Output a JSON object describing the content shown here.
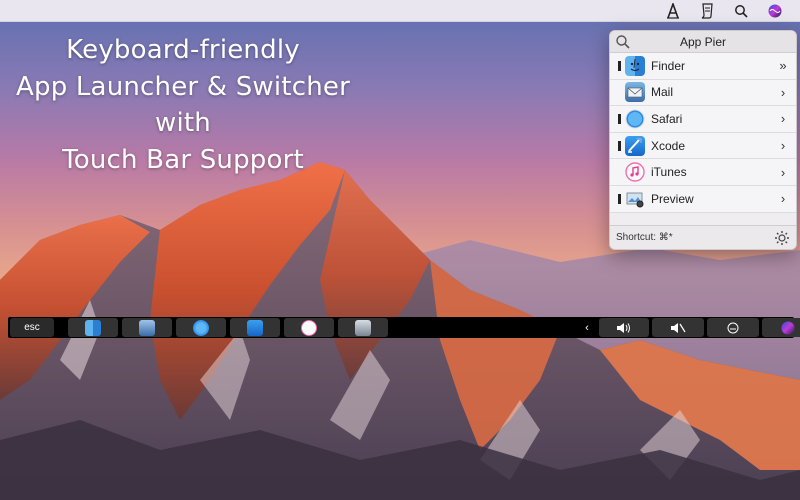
{
  "menubar": {
    "icons": [
      "app-pier-icon",
      "script-icon",
      "search-icon",
      "siri-icon"
    ]
  },
  "headline": {
    "lines": [
      "Keyboard-friendly",
      "App Launcher & Switcher",
      "with",
      "Touch Bar Support"
    ]
  },
  "panel": {
    "title": "App Pier",
    "apps": [
      {
        "name": "Finder",
        "running": true,
        "arrow": "»",
        "icon": "finder-icon"
      },
      {
        "name": "Mail",
        "running": false,
        "arrow": "›",
        "icon": "mail-icon"
      },
      {
        "name": "Safari",
        "running": true,
        "arrow": "›",
        "icon": "safari-icon"
      },
      {
        "name": "Xcode",
        "running": true,
        "arrow": "›",
        "icon": "xcode-icon"
      },
      {
        "name": "iTunes",
        "running": false,
        "arrow": "›",
        "icon": "itunes-icon"
      },
      {
        "name": "Preview",
        "running": true,
        "arrow": "›",
        "icon": "preview-icon"
      }
    ],
    "shortcut": "Shortcut: ⌘*"
  },
  "touchbar": {
    "esc": "esc",
    "apps": [
      "finder-icon",
      "preview-icon",
      "safari-icon",
      "xcode-icon",
      "itunes-icon",
      "scanner-icon"
    ],
    "controls": {
      "collapse": "‹",
      "volume": "volume-icon",
      "mute": "mute-icon",
      "dictation": "dictation-icon",
      "siri": "siri-icon"
    }
  },
  "colors": {
    "sky_top": "#5d6fb0",
    "sky_mid": "#d69092",
    "mountain_lit": "#e8603a",
    "touchbar_bg": "#000000",
    "panel_bg": "#f5f4f6"
  }
}
